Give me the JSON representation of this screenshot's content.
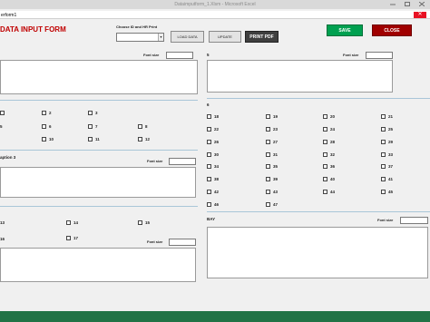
{
  "window": {
    "title": "Dataimputform_1.Xlsm - Microsoft Excel",
    "userform_title": "erform1"
  },
  "header": {
    "form_title": "DATA INPUT FORM",
    "choose_label": "Choose ID and HR Print",
    "load_data": "LOAD DATA",
    "update": "UPDATE",
    "print_pdf": "PRINT PDF",
    "save": "SAVE",
    "close": "CLOSE",
    "id_select_value": ""
  },
  "font_size_label": "Font size",
  "close_glyph": "✕",
  "dropdown_glyph": "▾",
  "sections": {
    "s5_label": "5",
    "s6_label": "6",
    "caption3_label": "aption 3",
    "bay_label": "BAY"
  },
  "checkboxes_left_top": [
    "2",
    "3",
    "5",
    "6",
    "7",
    "8",
    "10",
    "11",
    "12"
  ],
  "checkboxes_left_bottom": [
    "14",
    "15",
    "16",
    "17"
  ],
  "checkboxes_right": [
    "18",
    "19",
    "20",
    "21",
    "22",
    "23",
    "24",
    "25",
    "26",
    "27",
    "28",
    "29",
    "30",
    "31",
    "32",
    "33",
    "34",
    "35",
    "36",
    "37",
    "38",
    "39",
    "40",
    "41",
    "42",
    "43",
    "44",
    "45",
    "46",
    "47"
  ],
  "colors": {
    "save": "#00a050",
    "close": "#a00000",
    "title": "#c00000",
    "excel_green": "#217346"
  }
}
